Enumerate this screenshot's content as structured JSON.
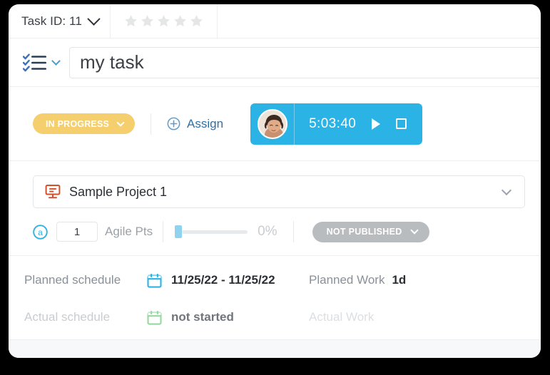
{
  "topbar": {
    "task_id_label": "Task ID: 11",
    "task_id_chevron_icon": "chevron-down-icon",
    "rating": {
      "stars_total": 5,
      "stars_filled": 0,
      "star_icon": "star-icon"
    }
  },
  "title_row": {
    "type_icon": "checklist-icon",
    "type_chevron_icon": "chevron-down-icon",
    "task_title": "my task",
    "task_title_placeholder": "Task name"
  },
  "status_row": {
    "status_label": "IN PROGRESS",
    "status_chevron_icon": "chevron-down-icon",
    "status_color": "#f5cf6d",
    "assign_icon": "plus-circle-icon",
    "assign_label": "Assign",
    "assign_color": "#2f6fa8",
    "timer": {
      "avatar_icon": "user-avatar",
      "elapsed": "5:03:40",
      "play_icon": "play-icon",
      "stop_icon": "stop-icon",
      "color": "#2cb3e5"
    }
  },
  "project_row": {
    "project_icon": "project-board-icon",
    "project_name": "Sample Project 1",
    "chevron_icon": "chevron-down-icon"
  },
  "meta_row": {
    "agile_badge_icon": "agile-a-icon",
    "agile_points": "1",
    "agile_points_placeholder": "0",
    "agile_label": "Agile Pts",
    "progress_percent": "0%",
    "progress_value": 0,
    "publish_label": "NOT PUBLISHED",
    "publish_chevron_icon": "chevron-down-icon",
    "publish_color": "#b9bcbf"
  },
  "schedule": {
    "planned": {
      "label": "Planned schedule",
      "calendar_icon": "calendar-icon",
      "value": "11/25/22 - 11/25/22",
      "work_label": "Planned Work",
      "work_value": "1d"
    },
    "actual": {
      "label": "Actual schedule",
      "calendar_icon": "calendar-icon",
      "value": "not started",
      "work_label": "Actual Work",
      "work_value": ""
    }
  }
}
